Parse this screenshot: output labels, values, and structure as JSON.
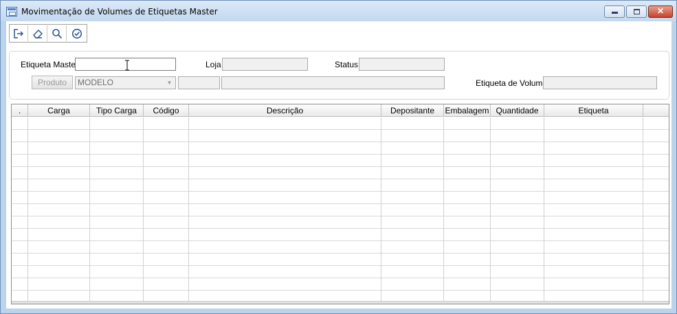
{
  "window": {
    "title": "Movimentação de Volumes de Etiquetas Master",
    "close_glyph": "✕"
  },
  "toolbar": {
    "buttons": [
      {
        "icon": "exit-icon"
      },
      {
        "icon": "eraser-icon"
      },
      {
        "icon": "search-icon"
      },
      {
        "icon": "confirm-check-icon"
      }
    ]
  },
  "filters": {
    "etiqueta_master_label": "Etiqueta Master",
    "etiqueta_master_value": "",
    "loja_label": "Loja",
    "loja_value": "",
    "status_label": "Status",
    "status_value": "",
    "produto_button": "Produto",
    "modelo_value": "MODELO",
    "produto_code_value": "",
    "produto_desc_value": "",
    "etiqueta_volume_label": "Etiqueta de Volume",
    "etiqueta_volume_value": ""
  },
  "grid": {
    "columns": [
      ".",
      "Carga",
      "Tipo Carga",
      "Código",
      "Descrição",
      "Depositante",
      "Embalagem",
      "Quantidade",
      "Etiqueta",
      ""
    ],
    "rows": []
  }
}
